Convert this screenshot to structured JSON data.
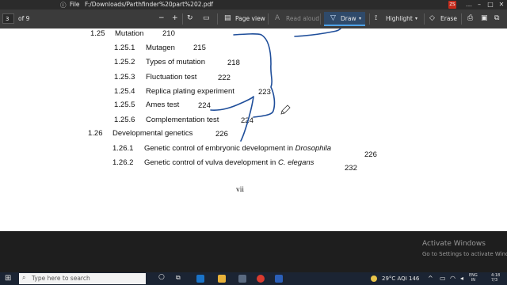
{
  "titlebar": {
    "file_menu": "File",
    "path": "F:/Downloads/Parthfinder%20part%202.pdf",
    "avatar_initials": "ZS"
  },
  "toolbar": {
    "page_current": "3",
    "page_total": "of 9",
    "page_view": "Page view",
    "read_aloud": "Read aloud",
    "draw": "Draw",
    "highlight": "Highlight",
    "erase": "Erase"
  },
  "toc": [
    {
      "num": "1.25",
      "title": "Mutation",
      "page": "210"
    },
    {
      "num": "1.25.1",
      "title": "Mutagen",
      "page": "215"
    },
    {
      "num": "1.25.2",
      "title": "Types of mutation",
      "page": "218"
    },
    {
      "num": "1.25.3",
      "title": "Fluctuation test",
      "page": "222"
    },
    {
      "num": "1.25.4",
      "title": "Replica plating experiment",
      "page": "223"
    },
    {
      "num": "1.25.5",
      "title": "Ames test",
      "page": "224"
    },
    {
      "num": "1.25.6",
      "title": "Complementation test",
      "page": "224"
    },
    {
      "num": "1.26",
      "title": "Developmental genetics",
      "page": "226"
    },
    {
      "num": "1.26.1",
      "title": "Genetic control of embryonic development in",
      "title_italic": "Drosophila",
      "page": "226"
    },
    {
      "num": "1.26.2",
      "title": "Genetic control of vulva development in",
      "title_italic": "C. elegans",
      "page": "232"
    }
  ],
  "page_footer": "vii",
  "watermark": {
    "line1": "Activate Windows",
    "line2": "Go to Settings to activate Windows."
  },
  "taskbar": {
    "search_placeholder": "Type here to search",
    "weather": "29°C  AQI 146",
    "lang_top": "ENG",
    "lang_bottom": "IN",
    "time": "4:18",
    "date": "7/3"
  },
  "colors": {
    "ink": "#1f4e9a",
    "accent": "#4fa3e8"
  }
}
